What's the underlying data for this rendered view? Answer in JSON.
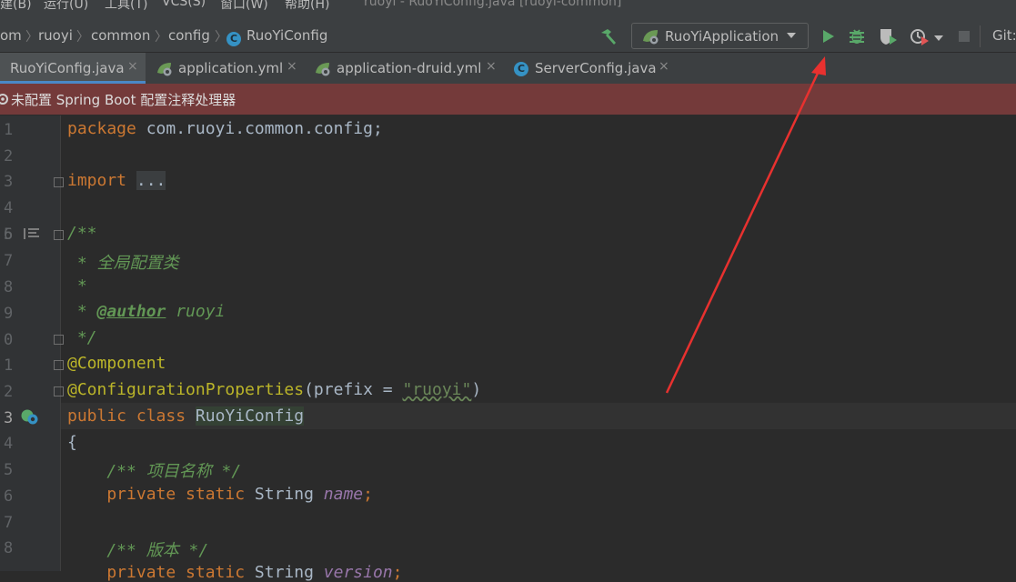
{
  "menubar": {
    "items": [
      "建(B)",
      "运行(U)",
      "工具(T)",
      "VCS(S)",
      "窗口(W)",
      "帮助(H)"
    ],
    "window_title": "ruoyi - RuoYiConfig.java [ruoyi-common]"
  },
  "breadcrumb": {
    "items": [
      "om",
      "ruoyi",
      "common",
      "config",
      "RuoYiConfig"
    ],
    "class_icon_letter": "C"
  },
  "toolbar": {
    "run_config": "RuoYiApplication",
    "vcs_label": "Git:",
    "icons": [
      "hammer-icon",
      "run-icon",
      "debug-icon",
      "coverage-icon",
      "profile-icon",
      "stop-icon"
    ]
  },
  "tabs": [
    {
      "label": "RuoYiConfig.java",
      "icon": "class-icon",
      "active": true
    },
    {
      "label": "application.yml",
      "icon": "spring-yml-icon",
      "active": false
    },
    {
      "label": "application-druid.yml",
      "icon": "spring-yml-icon",
      "active": false
    },
    {
      "label": "ServerConfig.java",
      "icon": "class-icon",
      "active": false
    }
  ],
  "tab_close_glyph": "×",
  "notification": {
    "text": "未配置 Spring Boot 配置注释处理器"
  },
  "line_numbers": [
    "1",
    "2",
    "3",
    "4",
    "5",
    "6",
    "7",
    "8",
    "9",
    "0",
    "1",
    "2",
    "3",
    "4",
    "5",
    "6",
    "7",
    "8"
  ],
  "code": {
    "l1_kw": "package",
    "l1_rest": " com.ruoyi.common.config;",
    "l3_kw": "import",
    "l3_fold": "...",
    "l6": "/**",
    "l7": " * 全局配置类",
    "l8": " *",
    "l9_pre": " * ",
    "l9_tag": "@author",
    "l9_post": " ruoyi",
    "l10": " */",
    "l11": "@Component",
    "l12_ann": "@ConfigurationProperties",
    "l12_a": "(prefix = ",
    "l12_str": "\"ruoyi\"",
    "l12_b": ")",
    "l13_kw": "public class ",
    "l13_name": "RuoYiConfig",
    "l14": "{",
    "l15": "    /** 项目名称 */",
    "l16_kw": "    private static ",
    "l16_type": "String ",
    "l16_fld": "name",
    "l16_end": ";",
    "l18": "    /** 版本 */",
    "l19_kw": "    private static ",
    "l19_type": "String ",
    "l19_fld": "version",
    "l19_end": ";"
  },
  "colors": {
    "accent": "#4a88c7",
    "arrow": "#e8312f",
    "run_green": "#59a869",
    "notice_bg": "#743a3a"
  }
}
